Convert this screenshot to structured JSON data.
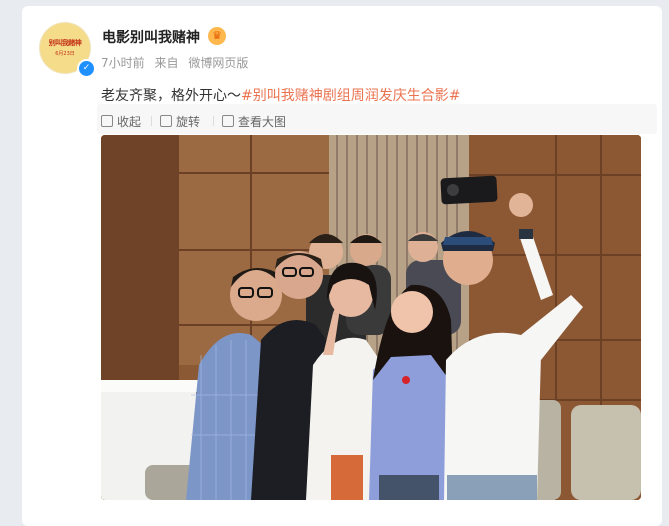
{
  "author": {
    "name": "电影别叫我赌神",
    "avatar_logo": "别叫我赌神",
    "avatar_date": "6月23日",
    "verified_icon": "verified-badge-icon",
    "crown_icon": "crown-icon"
  },
  "meta": {
    "time": "7小时前",
    "source_prefix": "来自",
    "source": "微博网页版"
  },
  "post": {
    "text": "老友齐聚，格外开心～",
    "hashtag": "#别叫我赌神剧组周润发庆生合影#"
  },
  "toolbar": {
    "collapse_label": "收起",
    "rotate_label": "旋转",
    "view_label": "查看大图"
  },
  "image": {
    "description_icon": "group-selfie-photo"
  },
  "colors": {
    "hashtag": "#eb7350",
    "background": "#e8ecf1"
  }
}
